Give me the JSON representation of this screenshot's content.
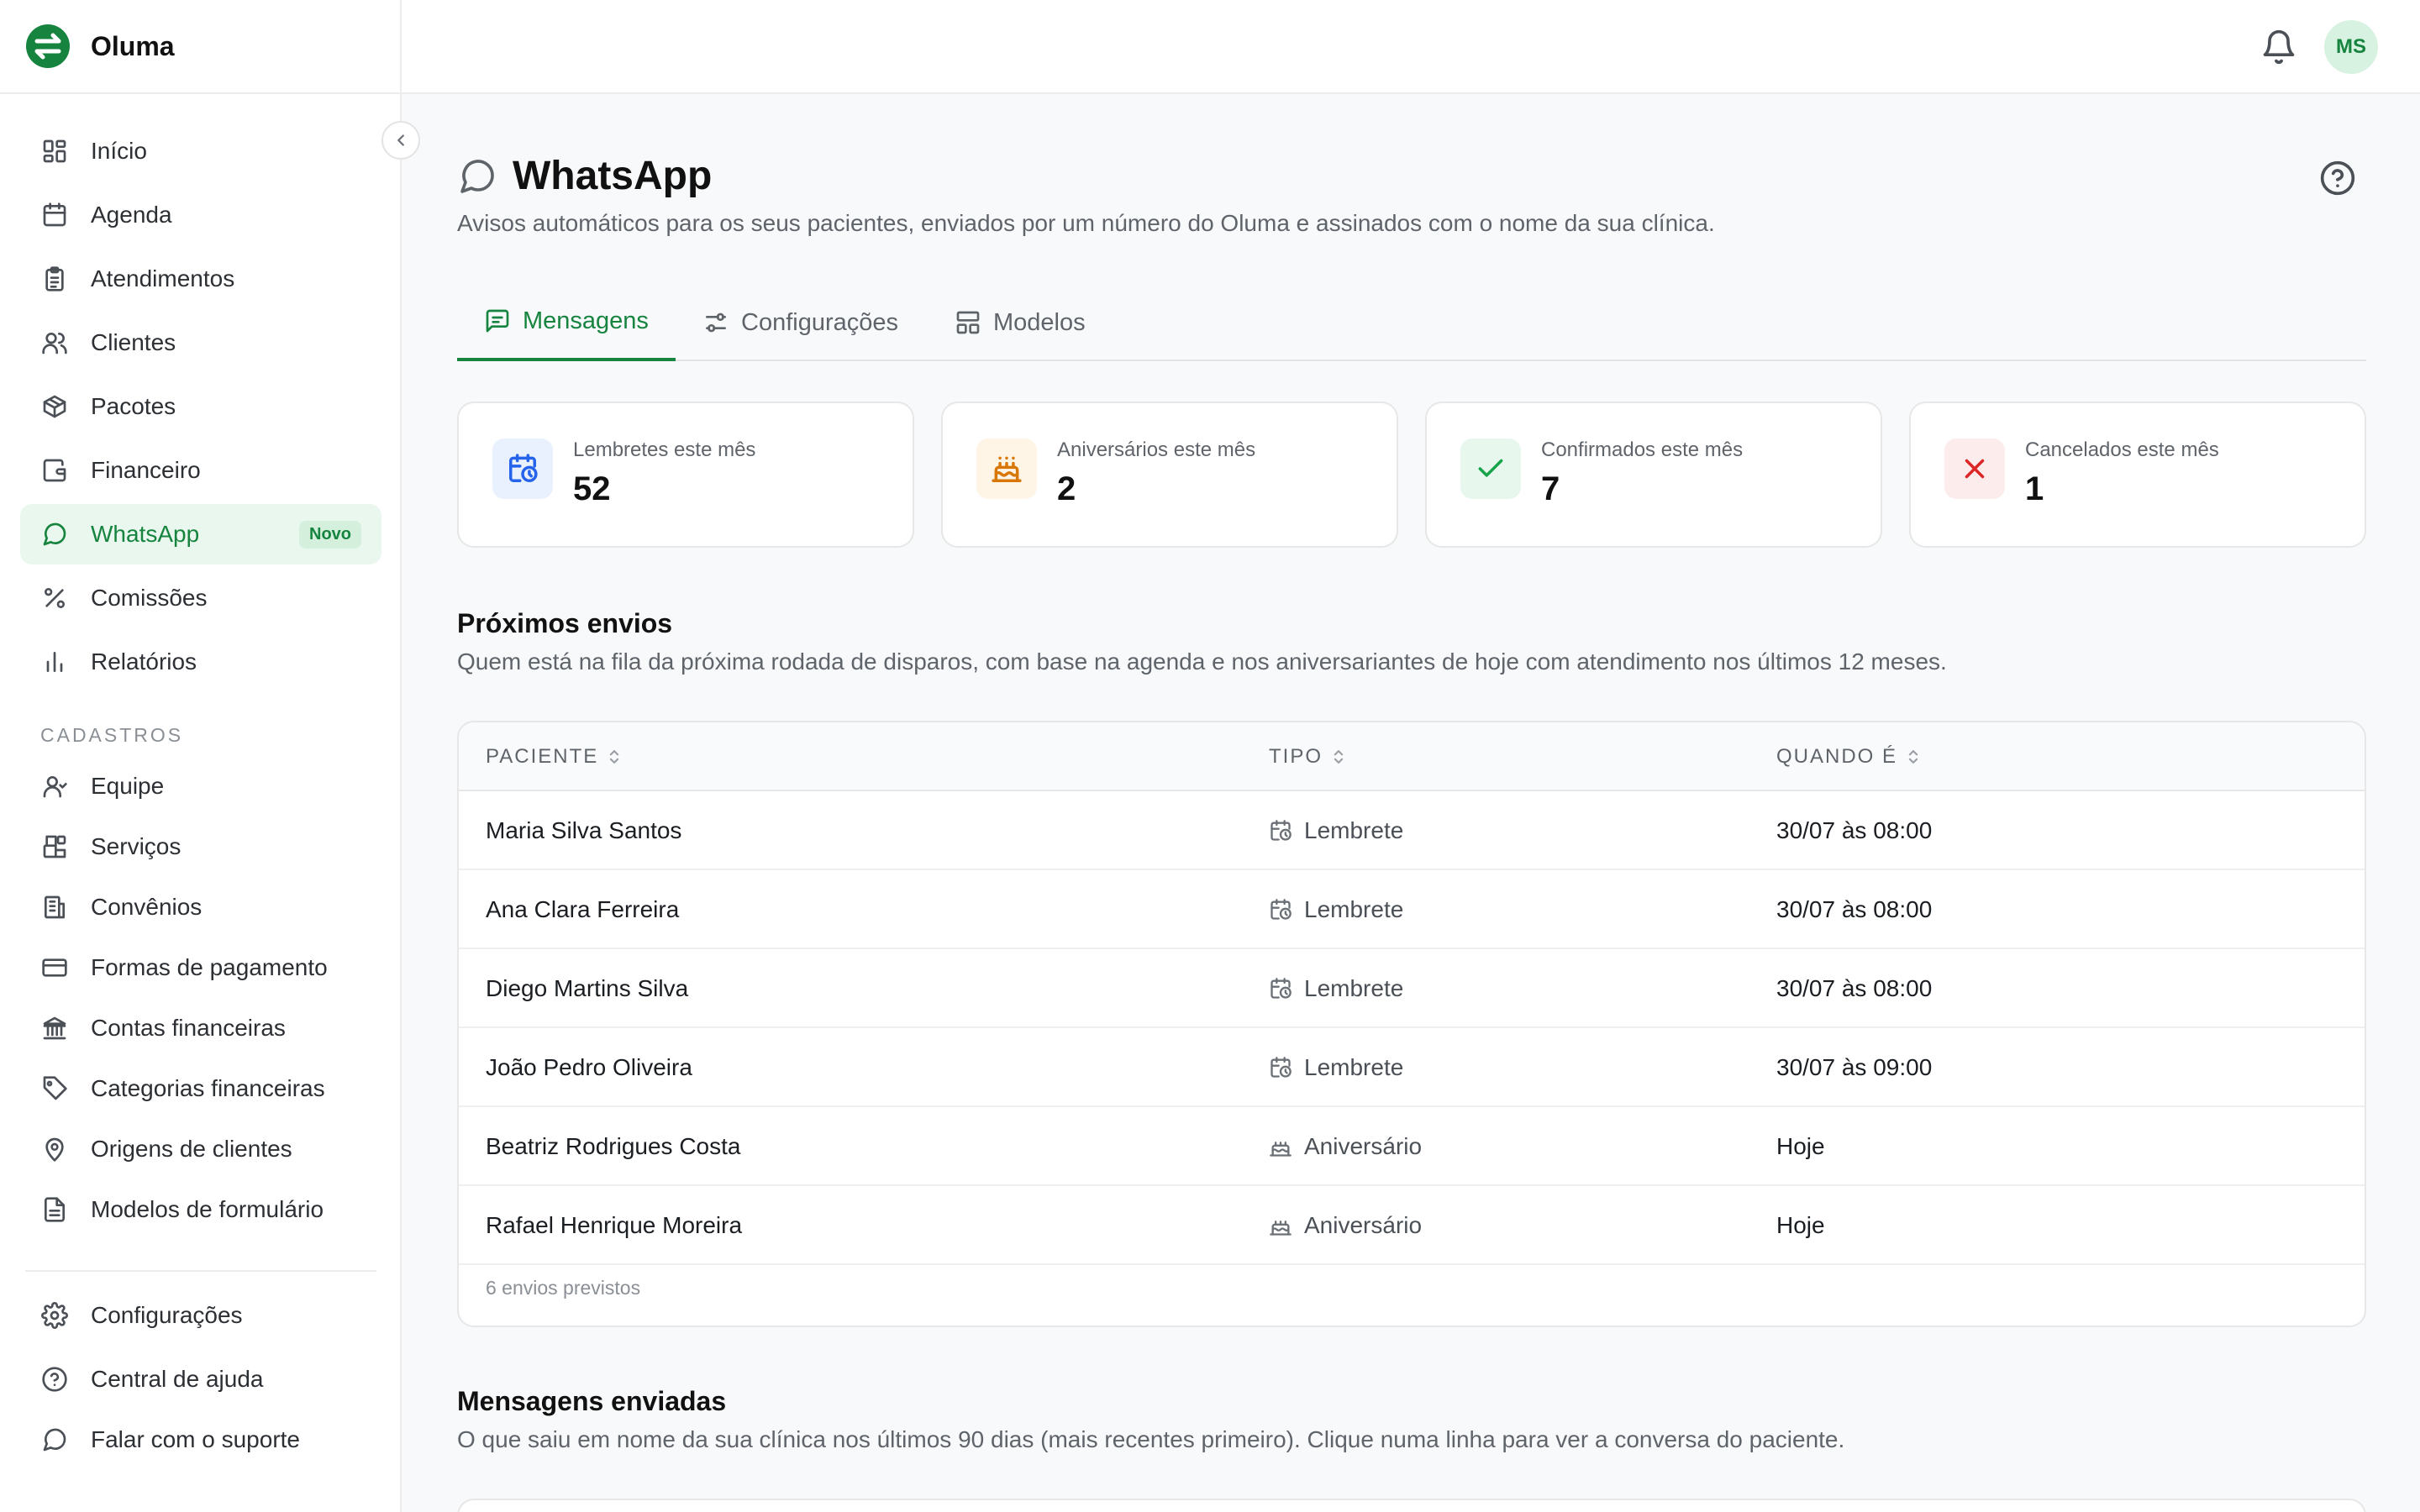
{
  "brand": {
    "name": "Oluma",
    "color": "#16843f"
  },
  "sidebar": {
    "items": [
      {
        "label": "Início",
        "icon": "grid-icon"
      },
      {
        "label": "Agenda",
        "icon": "calendar-icon"
      },
      {
        "label": "Atendimentos",
        "icon": "clipboard-icon"
      },
      {
        "label": "Clientes",
        "icon": "users-icon"
      },
      {
        "label": "Pacotes",
        "icon": "package-icon"
      },
      {
        "label": "Financeiro",
        "icon": "wallet-icon"
      },
      {
        "label": "WhatsApp",
        "icon": "chat-icon",
        "active": true,
        "badge": "Novo"
      },
      {
        "label": "Comissões",
        "icon": "percent-icon"
      },
      {
        "label": "Relatórios",
        "icon": "bar-chart-icon"
      }
    ],
    "section_label": "CADASTROS",
    "cadastros": [
      {
        "label": "Equipe",
        "icon": "user-icon"
      },
      {
        "label": "Serviços",
        "icon": "blocks-icon"
      },
      {
        "label": "Convênios",
        "icon": "building-icon"
      },
      {
        "label": "Formas de pagamento",
        "icon": "credit-card-icon"
      },
      {
        "label": "Contas financeiras",
        "icon": "bank-icon"
      },
      {
        "label": "Categorias financeiras",
        "icon": "tag-icon"
      },
      {
        "label": "Origens de clientes",
        "icon": "map-pin-icon"
      },
      {
        "label": "Modelos de formulário",
        "icon": "file-text-icon"
      }
    ],
    "footer": [
      {
        "label": "Configurações",
        "icon": "gear-icon"
      },
      {
        "label": "Central de ajuda",
        "icon": "help-circle-icon"
      },
      {
        "label": "Falar com o suporte",
        "icon": "chat-icon"
      }
    ]
  },
  "header": {
    "avatar_initials": "MS"
  },
  "page": {
    "title": "WhatsApp",
    "subtitle": "Avisos automáticos para os seus pacientes, enviados por um número do Oluma e assinados com o nome da sua clínica."
  },
  "tabs": [
    {
      "label": "Mensagens",
      "active": true
    },
    {
      "label": "Configurações"
    },
    {
      "label": "Modelos"
    }
  ],
  "stats": [
    {
      "label": "Lembretes este mês",
      "value": "52",
      "icon": "calendar-clock-icon",
      "color": "#2563eb",
      "bg": "#eaf1fe"
    },
    {
      "label": "Aniversários este mês",
      "value": "2",
      "icon": "cake-icon",
      "color": "#d97706",
      "bg": "#fef5e6"
    },
    {
      "label": "Confirmados este mês",
      "value": "7",
      "icon": "check-icon",
      "color": "#16a34a",
      "bg": "#e8f7ee"
    },
    {
      "label": "Cancelados este mês",
      "value": "1",
      "icon": "x-icon",
      "color": "#dc2626",
      "bg": "#fdecec"
    }
  ],
  "upcoming": {
    "title": "Próximos envios",
    "description": "Quem está na fila da próxima rodada de disparos, com base na agenda e nos aniversariantes de hoje com atendimento nos últimos 12 meses.",
    "columns": [
      "PACIENTE",
      "TIPO",
      "QUANDO É"
    ],
    "rows": [
      {
        "patient": "Maria Silva Santos",
        "type": "Lembrete",
        "when": "30/07 às 08:00"
      },
      {
        "patient": "Ana Clara Ferreira",
        "type": "Lembrete",
        "when": "30/07 às 08:00"
      },
      {
        "patient": "Diego Martins Silva",
        "type": "Lembrete",
        "when": "30/07 às 08:00"
      },
      {
        "patient": "João Pedro Oliveira",
        "type": "Lembrete",
        "when": "30/07 às 09:00"
      },
      {
        "patient": "Beatriz Rodrigues Costa",
        "type": "Aniversário",
        "when": "Hoje"
      },
      {
        "patient": "Rafael Henrique Moreira",
        "type": "Aniversário",
        "when": "Hoje"
      }
    ],
    "footer": "6 envios previstos"
  },
  "sent": {
    "title": "Mensagens enviadas",
    "description": "O que saiu em nome da sua clínica nos últimos 90 dias (mais recentes primeiro). Clique numa linha para ver a conversa do paciente."
  }
}
